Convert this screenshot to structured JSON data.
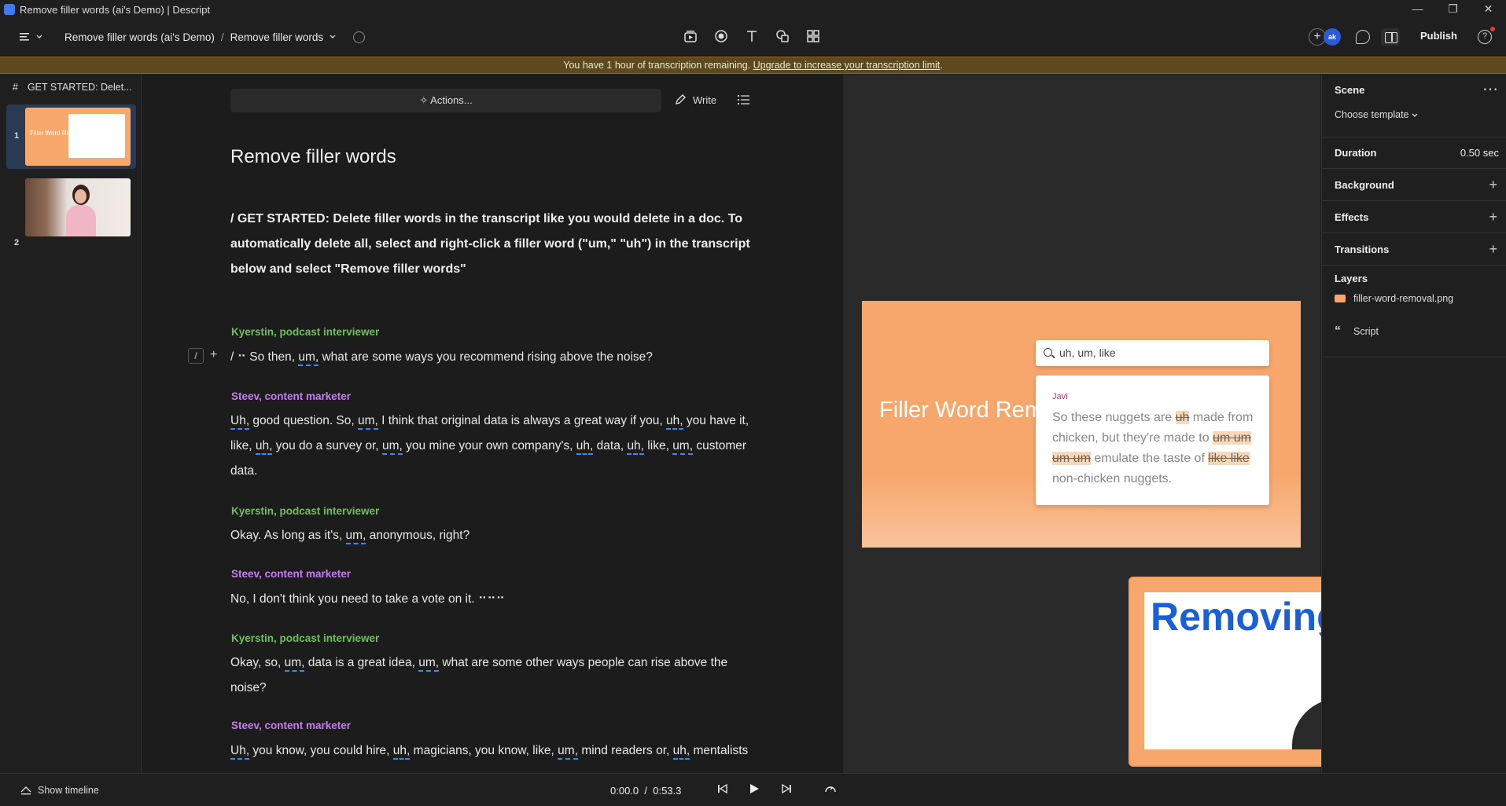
{
  "window": {
    "title": "Remove filler words (ai's Demo) | Descript",
    "controls": [
      "—",
      "❐",
      "✕"
    ]
  },
  "topbar": {
    "breadcrumb_project": "Remove filler words (ai's Demo)",
    "breadcrumb_sep": "/",
    "breadcrumb_composition": "Remove filler words",
    "avatar_initials": "ak",
    "publish_label": "Publish"
  },
  "banner": {
    "text": "You have 1 hour of transcription remaining.",
    "link": "Upgrade to increase your transcription limit",
    "suffix": "."
  },
  "scenes": {
    "header_hash": "#",
    "header_title": "GET STARTED: Delet...",
    "items": [
      {
        "num": "1",
        "thumb_title": "Filler Word Removal"
      },
      {
        "num": "2"
      }
    ]
  },
  "editor": {
    "actions_label": "Actions...",
    "write_label": "Write",
    "title": "Remove filler words",
    "intro": "/ GET STARTED: Delete filler words in the transcript like you would delete in a doc. To automatically delete all, select and right-click a filler word (\"um,\" \"uh\") in the transcript below and select \"Remove filler words\"",
    "slash_marker": "/",
    "blocks": [
      {
        "speaker": "Kyerstin, podcast interviewer"
      },
      {
        "speaker": "Steev, content marketer"
      },
      {
        "speaker": "Kyerstin, podcast interviewer"
      },
      {
        "speaker": "Steev, content marketer"
      },
      {
        "speaker": "Kyerstin, podcast interviewer"
      },
      {
        "speaker": "Steev, content marketer"
      }
    ],
    "t": {
      "b0_a": "/ ⠒ So then, ",
      "b0_f1": "um,",
      "b0_b": " what are some ways you recommend rising above the noise?",
      "b1_f1": "Uh,",
      "b1_a": " good question. So, ",
      "b1_f2": "um,",
      "b1_b": " I think that original data is always a great way if you, ",
      "b1_f3": "uh,",
      "b1_c": " you have it, like, ",
      "b1_f4": "uh,",
      "b1_d": " you do a survey or, ",
      "b1_f5": "um,",
      "b1_e": " you mine your own company's, ",
      "b1_f6": "uh,",
      "b1_f": " data, ",
      "b1_f7": "uh,",
      "b1_g": " like, ",
      "b1_f8": "um,",
      "b1_h": " customer data.",
      "b2_a": "Okay. As long as it's, ",
      "b2_f1": "um,",
      "b2_b": " anonymous, right?",
      "b3_a": " No, I don't think you need to take a vote on it. ⠒⠒⠒",
      "b4_a": "Okay, so, ",
      "b4_f1": "um,",
      "b4_b": " data is a great idea, ",
      "b4_f2": "um,",
      "b4_c": " what are some other ways people can rise above the noise?",
      "b5_f1": "Uh,",
      "b5_a": " you know, you could hire, ",
      "b5_f2": "uh,",
      "b5_b": " magicians, you know, like, ",
      "b5_f3": "um,",
      "b5_c": " mind readers or, ",
      "b5_f4": "uh,",
      "b5_d": " mentalists"
    }
  },
  "preview": {
    "canvas_title": "Filler Word Removal",
    "search_text": "uh, um, like",
    "card_name": "Javi",
    "card_t1": "So these nuggets are ",
    "card_h1": "uh",
    "card_t2": " made from chicken, but they're made to ",
    "card_h2": "um um um um",
    "card_t3": " emulate the taste of ",
    "card_h3": "like like",
    "card_t4": " non-chicken nuggets.",
    "pip_word": "Removing"
  },
  "properties": {
    "scene_label": "Scene",
    "template_label": "Choose template",
    "duration_label": "Duration",
    "duration_value": "0.50 sec",
    "background_label": "Background",
    "effects_label": "Effects",
    "transitions_label": "Transitions",
    "layers_label": "Layers",
    "layers": [
      {
        "name": "filler-word-removal.png",
        "icon": "image-icon"
      },
      {
        "name": "Script",
        "icon": "quote-icon"
      }
    ]
  },
  "bottombar": {
    "show_timeline": "Show timeline",
    "current_time": "0:00.0",
    "time_sep": "/",
    "total_time": "0:53.3"
  }
}
